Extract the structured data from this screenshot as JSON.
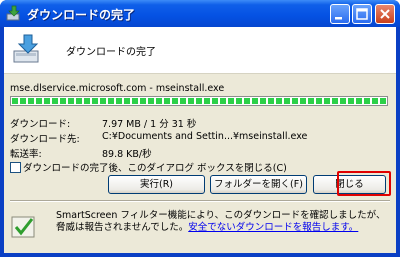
{
  "window": {
    "title": "ダウンロードの完了"
  },
  "header": {
    "text": "ダウンロードの完了"
  },
  "download": {
    "url": "mse.dlservice.microsoft.com - mseinstall.exe",
    "progress": 1.0,
    "rows": [
      {
        "label": "ダウンロード:",
        "value": "7.97 MB / 1 分 31 秒"
      },
      {
        "label": "ダウンロード先:",
        "value": "C:¥Documents and Settin...¥mseinstall.exe"
      },
      {
        "label": "転送率:",
        "value": "89.8 KB/秒"
      }
    ]
  },
  "checkbox": {
    "label": "ダウンロードの完了後、このダイアログ ボックスを閉じる(C)",
    "checked": false
  },
  "buttons": {
    "run": "実行(R)",
    "open_folder": "フォルダーを開く(F)",
    "close": "閉じる"
  },
  "footer": {
    "text": "SmartScreen フィルター機能により、このダウンロードを確認しましたが、脅威は報告されませんでした。",
    "link": "安全でないダウンロードを報告します。"
  },
  "colors": {
    "titlebar": "#0551e3",
    "progress": "#2cd048",
    "highlight": "#e00000"
  }
}
